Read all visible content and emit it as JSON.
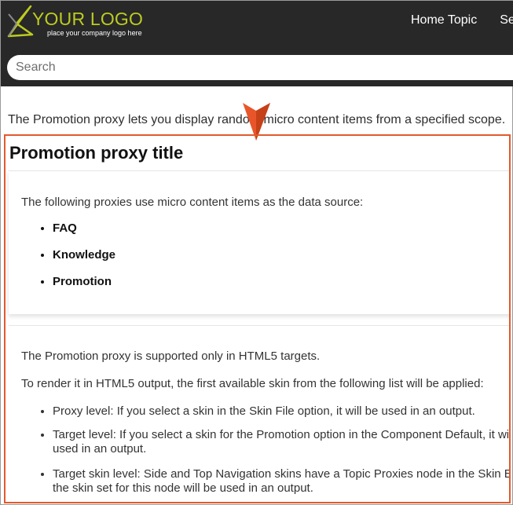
{
  "header": {
    "logo_text": "YOUR LOGO",
    "logo_tagline": "place your company logo here",
    "nav": [
      "Home Topic",
      "Se"
    ]
  },
  "search": {
    "placeholder": "Search"
  },
  "intro": "The Promotion proxy lets you display random micro content items from a specified scope.",
  "proxy": {
    "title": "Promotion proxy title",
    "sources_intro": "The following proxies use micro content items as the data source:",
    "sources": [
      "FAQ",
      "Knowledge",
      "Promotion"
    ],
    "support_note": "The Promotion proxy is supported only in HTML5 targets.",
    "render_note": "To render it in HTML5 output, the first available skin from the following list will be applied:",
    "levels": [
      "Proxy level: If you select a skin in the Skin File option, it will be used in an output.",
      "Target level: If you select a skin for the Promotion option in the Component Default, it will be used in an output.",
      "Target skin level: Side and Top Navigation skins have a Topic Proxies node in the Skin Editor; the skin set for this node will be used in an output."
    ]
  },
  "colors": {
    "header_bg": "#282828",
    "logo": "#bccb21",
    "marker": "#e9552a",
    "frame": "#e15a2e"
  }
}
